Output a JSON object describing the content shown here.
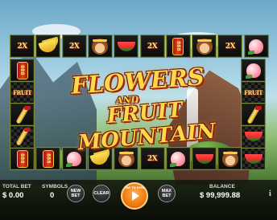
{
  "game": {
    "title_line1": "FLOWERS",
    "title_line2": "AND",
    "title_line3": "FRUIT MOUNTAIN"
  },
  "tiles": {
    "top": [
      "symbol-gold-ingot",
      "symbol-banana",
      "symbol-2x",
      "symbol-monkey",
      "symbol-watermelon",
      "symbol-2x",
      "symbol-scroll",
      "symbol-monkey",
      "symbol-2x",
      "symbol-peach"
    ],
    "left": [
      "symbol-scroll-vertical",
      "symbol-fruit-text",
      "symbol-staff",
      "symbol-staff"
    ],
    "right": [
      "symbol-peach",
      "symbol-fruit-text",
      "symbol-staff",
      "symbol-watermelon"
    ],
    "bottom": [
      "symbol-scroll",
      "symbol-scroll-vertical",
      "symbol-peach",
      "symbol-banana",
      "symbol-monkey",
      "symbol-2x",
      "symbol-peach",
      "symbol-watermelon",
      "symbol-monkey"
    ],
    "x2_label": "2X",
    "fruit_label": "FRUIT",
    "scroll_label": "888"
  },
  "bottom_bar": {
    "total_bet_label": "TOTAL BET",
    "total_bet_value": "$ 0.00",
    "symbols_label": "SYMBOLS",
    "symbols_value": "0",
    "new_bet_label": "NEW BET",
    "clear_label": "CLEAR",
    "spin_label": "TAP TO SPIN",
    "max_bet_label": "MAX BET",
    "balance_label": "BALANCE",
    "balance_value": "$ 99,999.88",
    "info_label": "i"
  },
  "colors": {
    "accent_gold": "#ffd84a",
    "title_shadow": "#a3250b",
    "spin_orange": "#f07a10",
    "tile_border": "#7a8a3a"
  }
}
